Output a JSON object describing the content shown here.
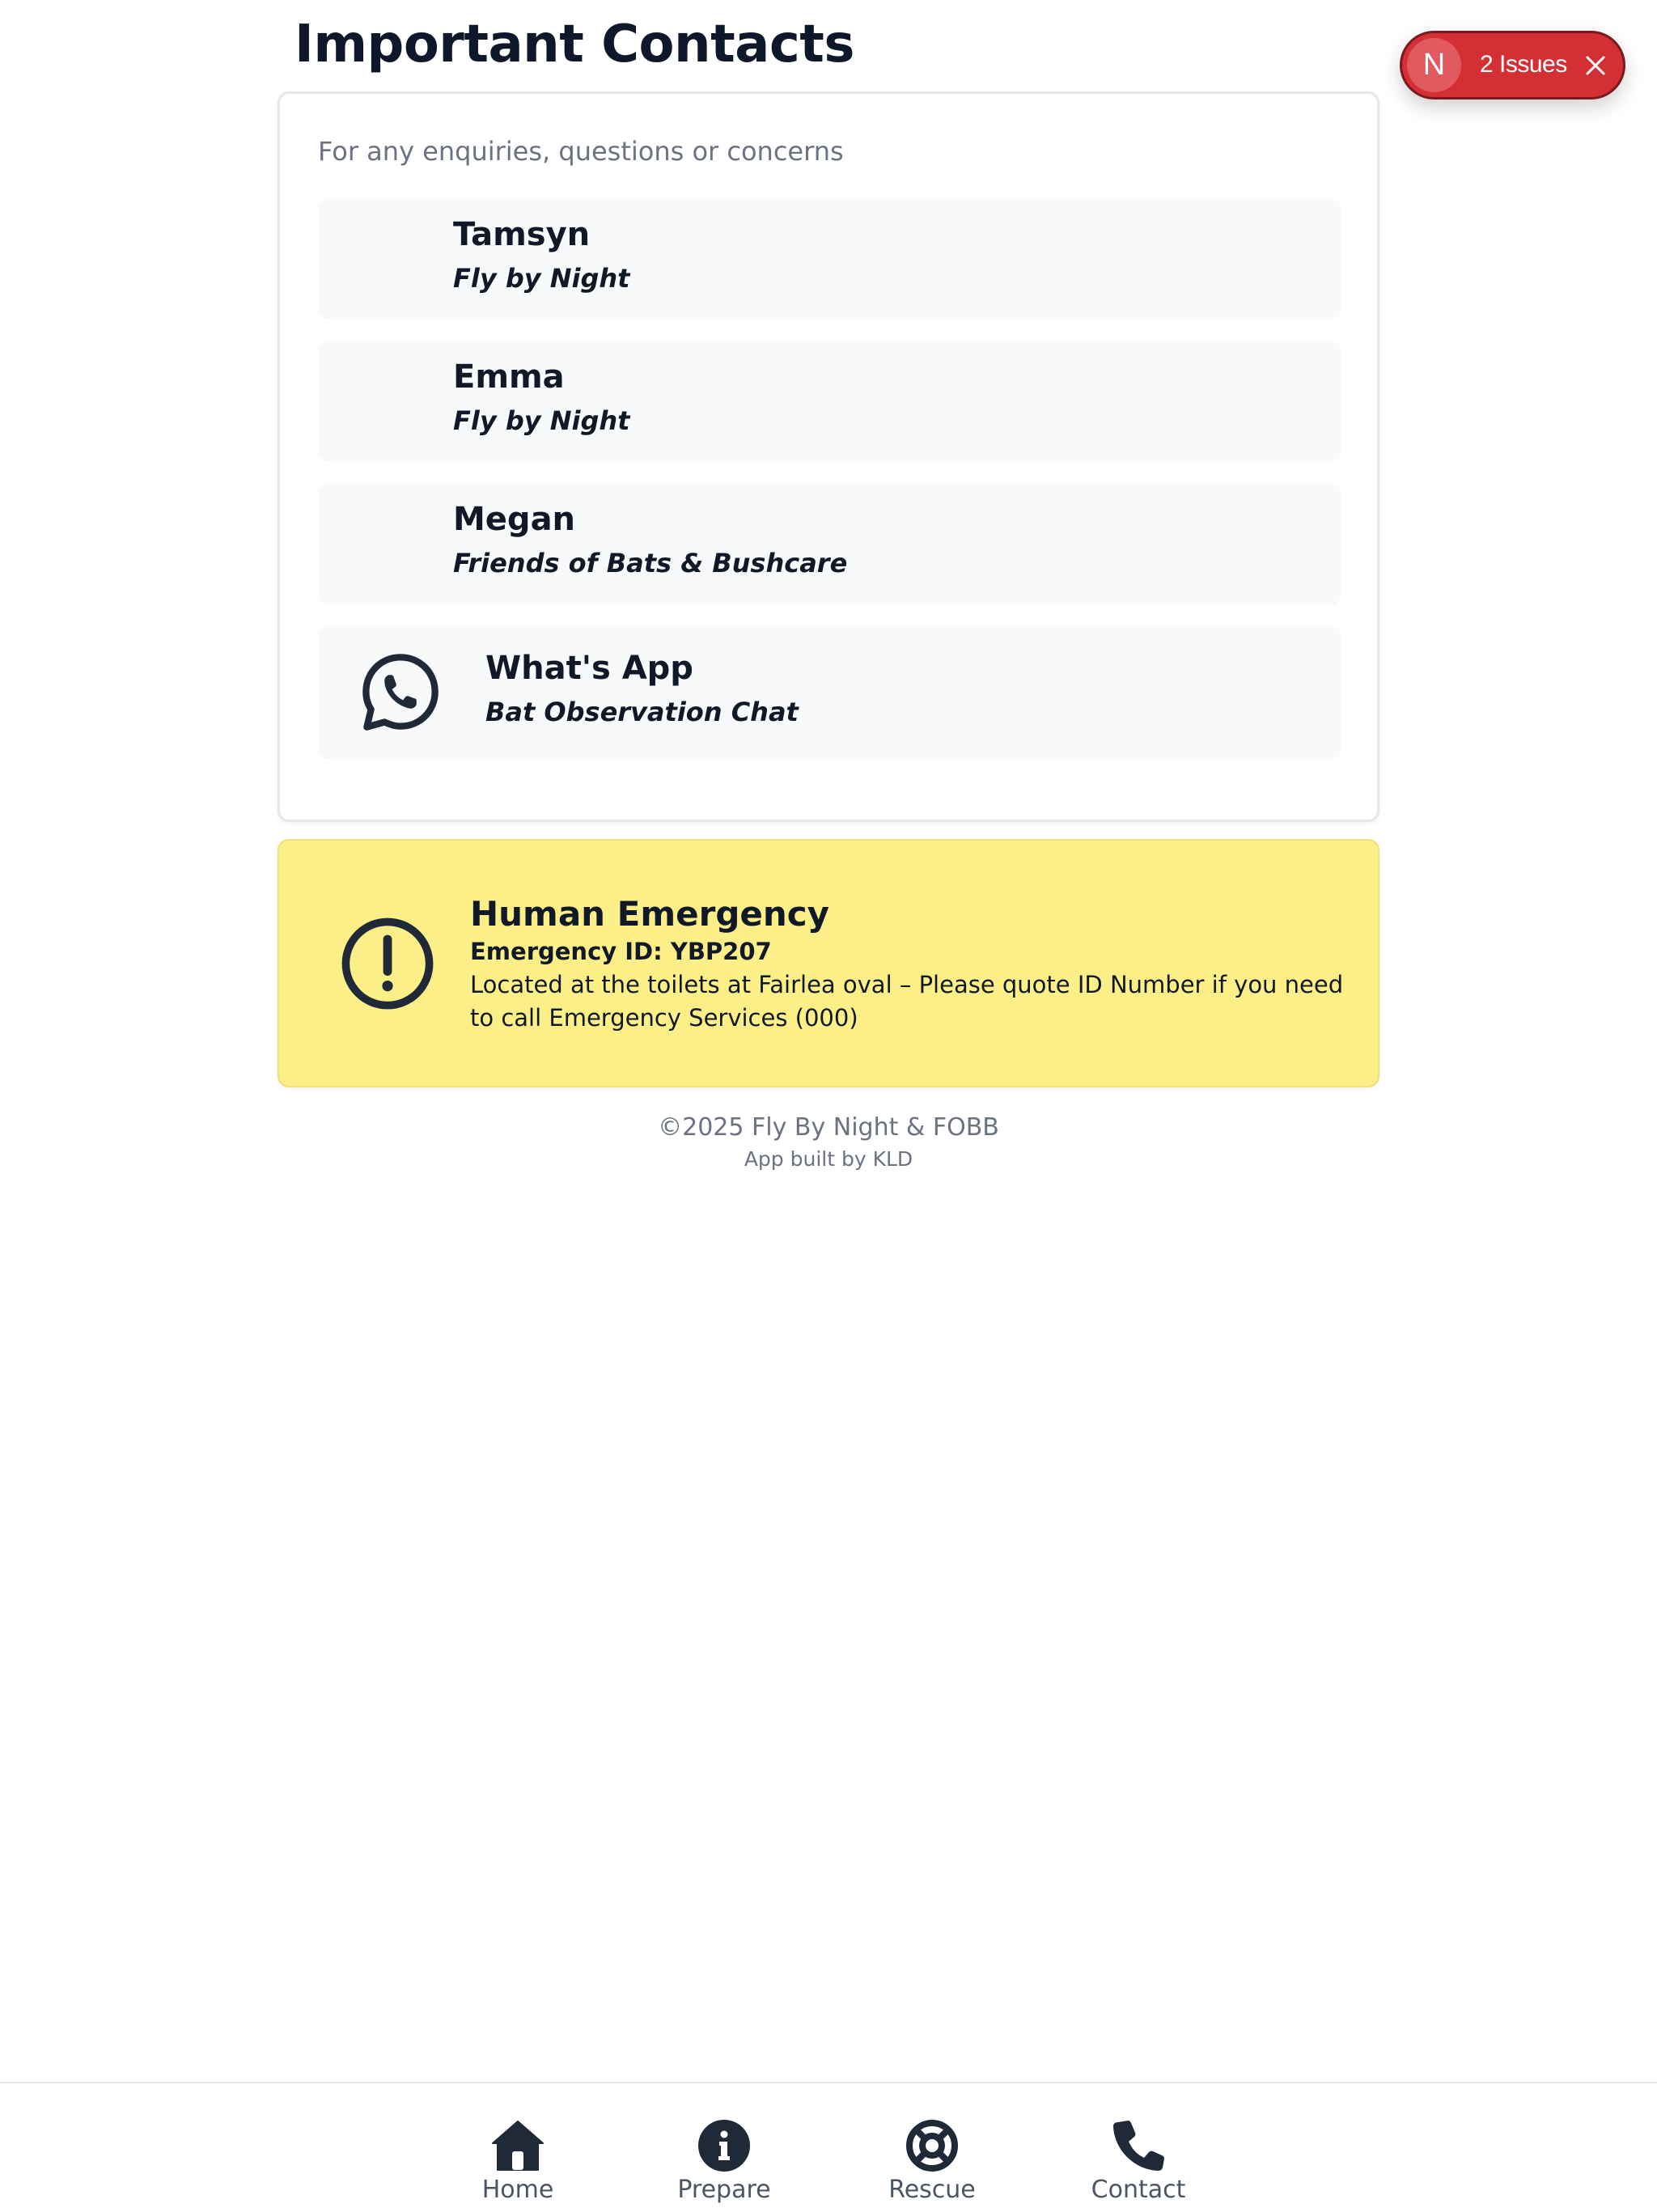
{
  "page": {
    "title": "Important Contacts"
  },
  "contacts_card": {
    "intro": "For any enquiries, questions or concerns",
    "items": [
      {
        "name": "Tamsyn",
        "organisation": "Fly by Night"
      },
      {
        "name": "Emma",
        "organisation": "Fly by Night"
      },
      {
        "name": "Megan",
        "organisation": "Friends of Bats & Bushcare"
      },
      {
        "name": "What's App",
        "organisation": "Bat Observation Chat",
        "icon": "whatsapp-icon"
      }
    ]
  },
  "emergency": {
    "title": "Human Emergency",
    "id_line": "Emergency ID: YBP207",
    "description": "Located at the toilets at Fairlea oval – Please quote ID Number if you need to call Emergency Services (000)",
    "icon": "alert-circle-icon",
    "background_color": "#fdef88"
  },
  "footer": {
    "copyright": "©2025 Fly By Night & FOBB",
    "credit": "App built by KLD"
  },
  "issues_badge": {
    "avatar_letter": "N",
    "label": "2 Issues",
    "color": "#d32f35"
  },
  "bottom_nav": {
    "items": [
      {
        "label": "Home",
        "icon": "home-icon"
      },
      {
        "label": "Prepare",
        "icon": "info-icon"
      },
      {
        "label": "Rescue",
        "icon": "lifebuoy-icon"
      },
      {
        "label": "Contact",
        "icon": "phone-icon"
      }
    ]
  }
}
